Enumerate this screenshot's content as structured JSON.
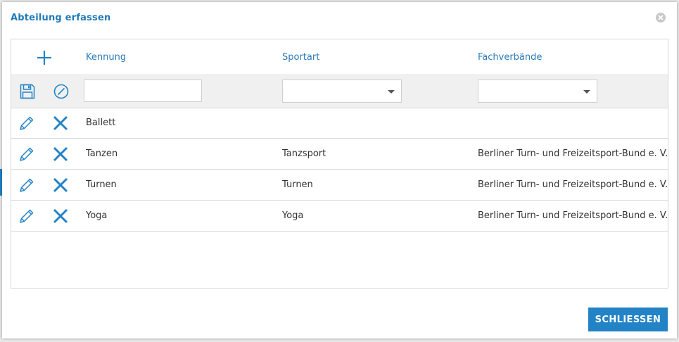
{
  "dialog": {
    "title": "Abteilung erfassen",
    "close_label": "SCHLIESSEN"
  },
  "grid": {
    "columns": [
      "Kennung",
      "Sportart",
      "Fachverbände"
    ],
    "filter": {
      "kennung_value": "",
      "sportart_value": "",
      "fachverbaende_value": ""
    },
    "rows": [
      {
        "kennung": "Ballett",
        "sportart": "",
        "fachverbaende": ""
      },
      {
        "kennung": "Tanzen",
        "sportart": "Tanzsport",
        "fachverbaende": "Berliner Turn- und Freizeitsport-Bund e. V."
      },
      {
        "kennung": "Turnen",
        "sportart": "Turnen",
        "fachverbaende": "Berliner Turn- und Freizeitsport-Bund e. V."
      },
      {
        "kennung": "Yoga",
        "sportart": "Yoga",
        "fachverbaende": "Berliner Turn- und Freizeitsport-Bund e. V."
      }
    ]
  },
  "icons": {
    "add": "plus-icon",
    "save": "floppy-disk-icon",
    "cancel": "cancel-circle-icon",
    "edit": "pencil-icon",
    "delete": "x-icon",
    "close": "close-circle-icon"
  },
  "colors": {
    "accent": "#2383c7",
    "title": "#1f7ab9",
    "header_text": "#2a7ab8"
  }
}
